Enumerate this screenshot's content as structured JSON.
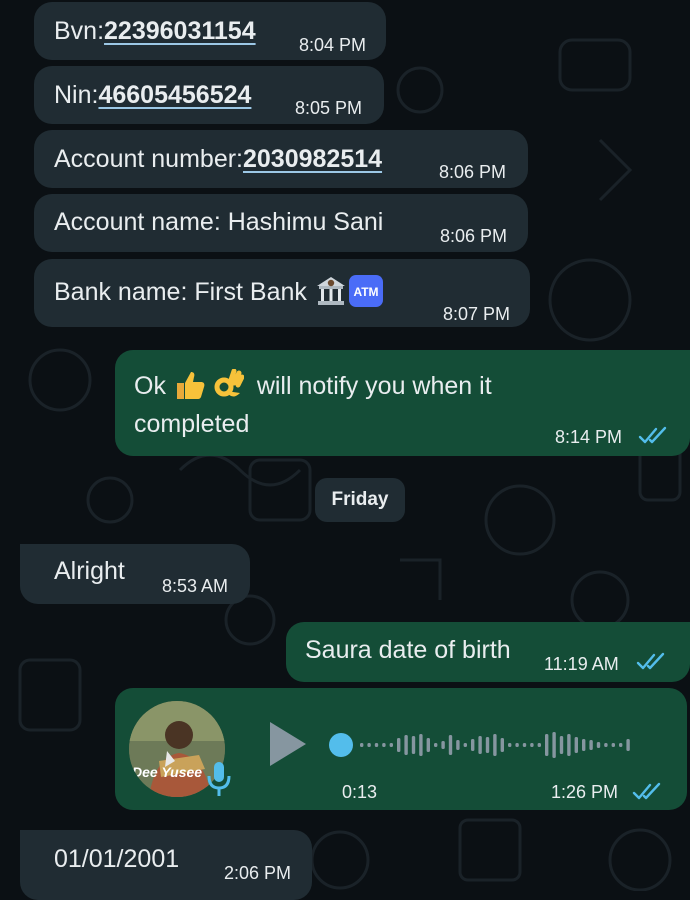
{
  "messages": [
    {
      "sender": "contact",
      "prefix": "Bvn:",
      "link": "22396031154",
      "time": "8:04 PM"
    },
    {
      "sender": "contact",
      "prefix": "Nin:",
      "link": "46605456524",
      "time": "8:05 PM"
    },
    {
      "sender": "contact",
      "prefix": "Account number:",
      "link": "2030982514",
      "time": "8:06 PM"
    },
    {
      "sender": "contact",
      "text": "Account name: Hashimu Sani",
      "time": "8:06 PM"
    },
    {
      "sender": "contact",
      "text": "Bank name: First Bank",
      "emojis": [
        "bank-emoji",
        "atm-emoji"
      ],
      "time": "8:07 PM"
    },
    {
      "sender": "me",
      "text_part1": "Ok",
      "text_part2": "will notify you when it",
      "text_line2": "completed",
      "emojis": [
        "thumbs-up-emoji",
        "ok-hand-emoji"
      ],
      "time": "8:14 PM",
      "status": "read"
    },
    {
      "sender": "contact",
      "text": "Alright",
      "time": "8:53 AM"
    },
    {
      "sender": "me",
      "text": "Saura date of birth",
      "time": "11:19 AM",
      "status": "read"
    },
    {
      "sender": "me",
      "type": "voice",
      "duration": "0:13",
      "time": "1:26 PM",
      "status": "read",
      "avatar_caption": "Dee Yusee"
    },
    {
      "sender": "contact",
      "text": "01/01/2001",
      "time": "2:06 PM"
    }
  ],
  "date_separator": "Friday",
  "colors": {
    "incoming": "#202c33",
    "outgoing": "#144d37",
    "read_ticks": "#53bdeb",
    "background": "#0b1014"
  }
}
